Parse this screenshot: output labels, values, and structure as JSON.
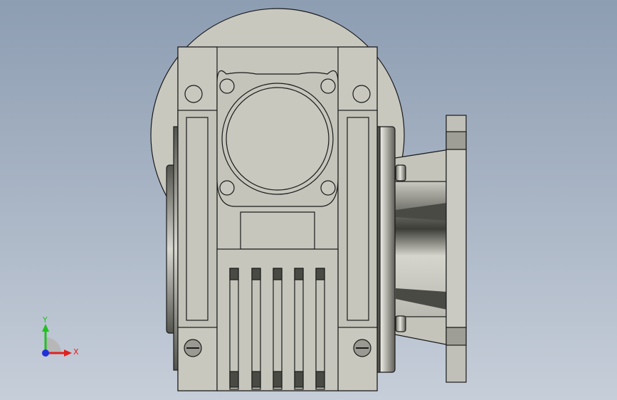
{
  "viewport": {
    "background_top": "#8d9db2",
    "background_bottom": "#c6ced9",
    "model_fill": "#c8c8bf",
    "model_stroke": "#1a1a1a",
    "dark_shade": "#3c3c38"
  },
  "triad": {
    "x_label": "X",
    "y_label": "Y",
    "x_color": "#e02020",
    "y_color": "#22c022",
    "z_color": "#2030d8"
  }
}
